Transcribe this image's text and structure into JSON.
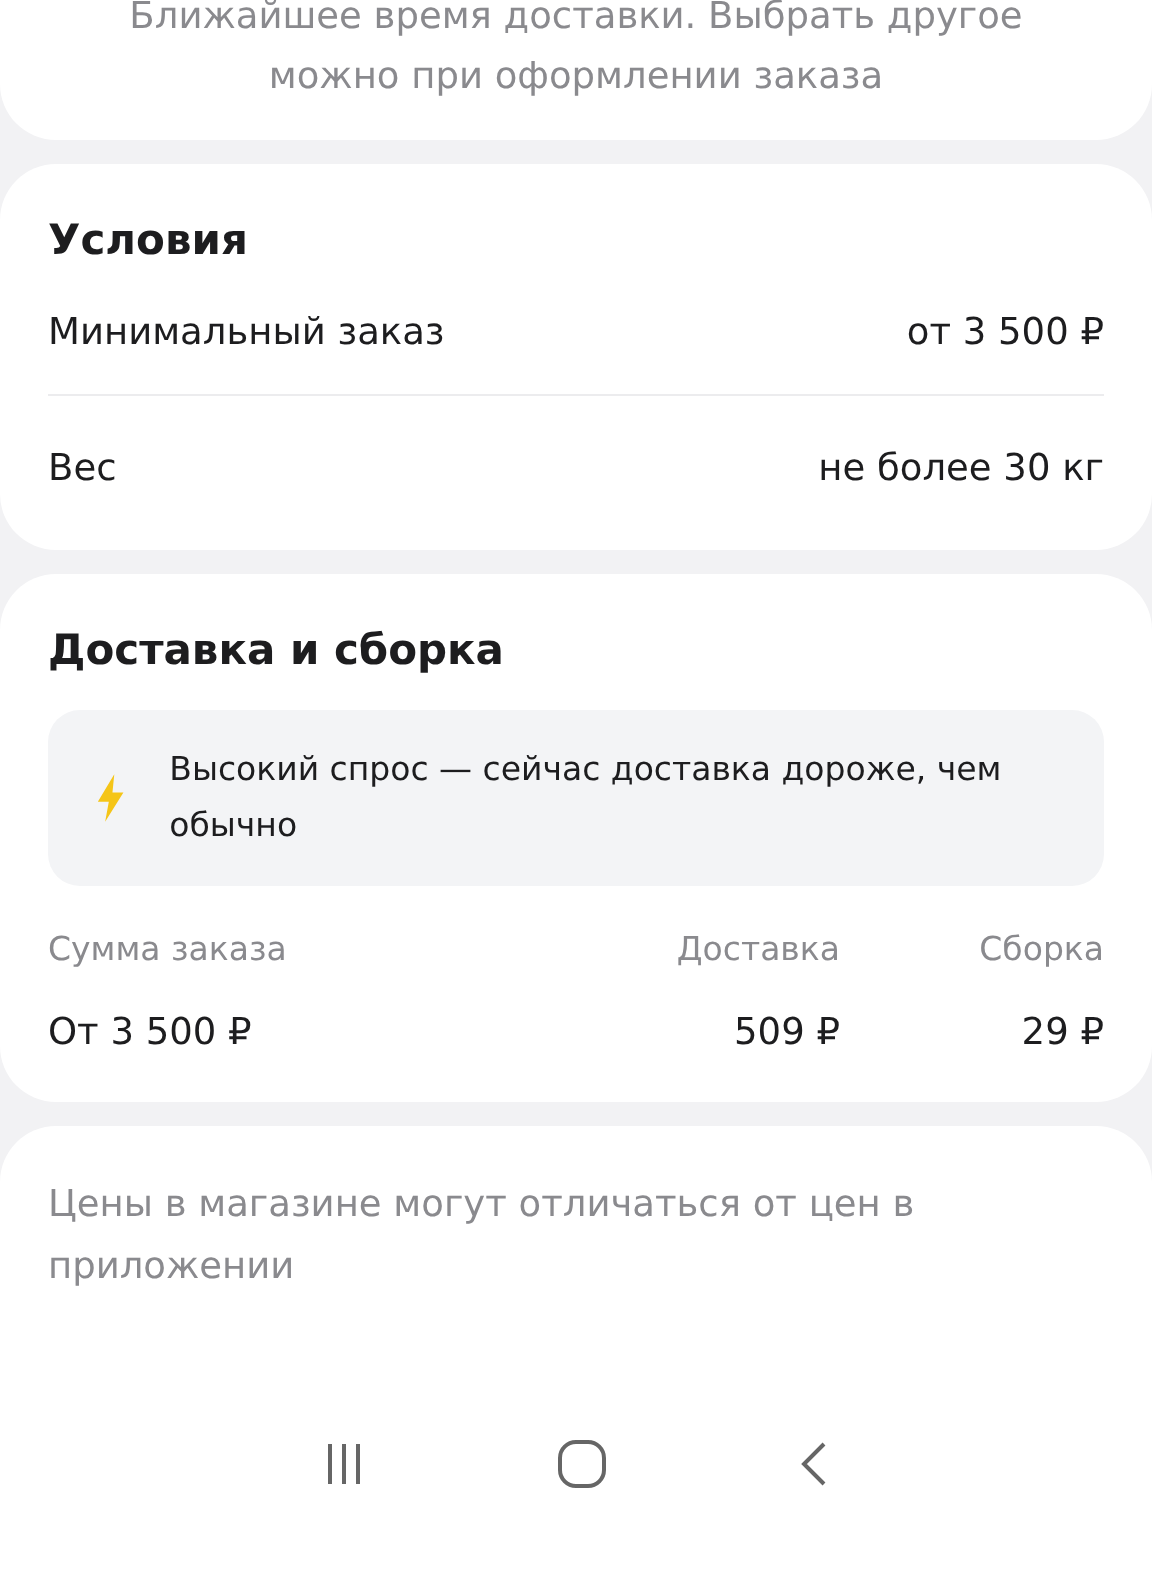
{
  "delivery_note": "Ближайшее время доставки. Выбрать другое можно при оформлении заказа",
  "conditions": {
    "title": "Условия",
    "rows": [
      {
        "label": "Минимальный заказ",
        "value": "от 3 500 ₽"
      },
      {
        "label": "Вес",
        "value": "не более 30 кг"
      }
    ]
  },
  "delivery": {
    "title": "Доставка и сборка",
    "notice": "Высокий спрос — сейчас доставка дороже, чем обычно",
    "table": {
      "columns": [
        "Сумма заказа",
        "Доставка",
        "Сборка"
      ],
      "rows": [
        [
          "От 3 500 ₽",
          "509 ₽",
          "29 ₽"
        ]
      ]
    }
  },
  "price_note": "Цены в магазине могут отличаться от цен в приложении"
}
